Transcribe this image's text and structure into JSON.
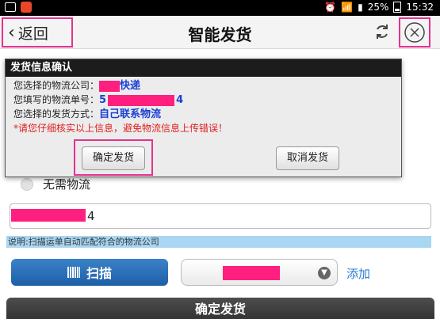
{
  "status_bar": {
    "battery": "25%",
    "time": "15:32"
  },
  "header": {
    "back_label": "返回",
    "title": "智能发货"
  },
  "dialog": {
    "title": "发货信息确认",
    "carrier_label": "您选择的物流公司：",
    "carrier_value": "快递",
    "tracking_label": "您填写的物流单号：",
    "tracking_prefix": "5",
    "tracking_suffix": "4",
    "method_label": "您选择的发货方式：",
    "method_value": "自己联系物流",
    "warning": "*请您仔细核实以上信息，避免物流信息上传错误！",
    "confirm_label": "确定发货",
    "cancel_label": "取消发货"
  },
  "form": {
    "no_logistics_label": "无需物流",
    "tracking_visible_suffix": "4",
    "note": "说明:扫描运单自动匹配符合的物流公司",
    "scan_label": "扫描",
    "add_label": "添加",
    "submit_label": "确定发货"
  },
  "colors": {
    "highlight": "#e5328f",
    "redaction": "#ff1f7f",
    "link": "#2a7bd4",
    "note_bg": "#a9d6f3"
  }
}
